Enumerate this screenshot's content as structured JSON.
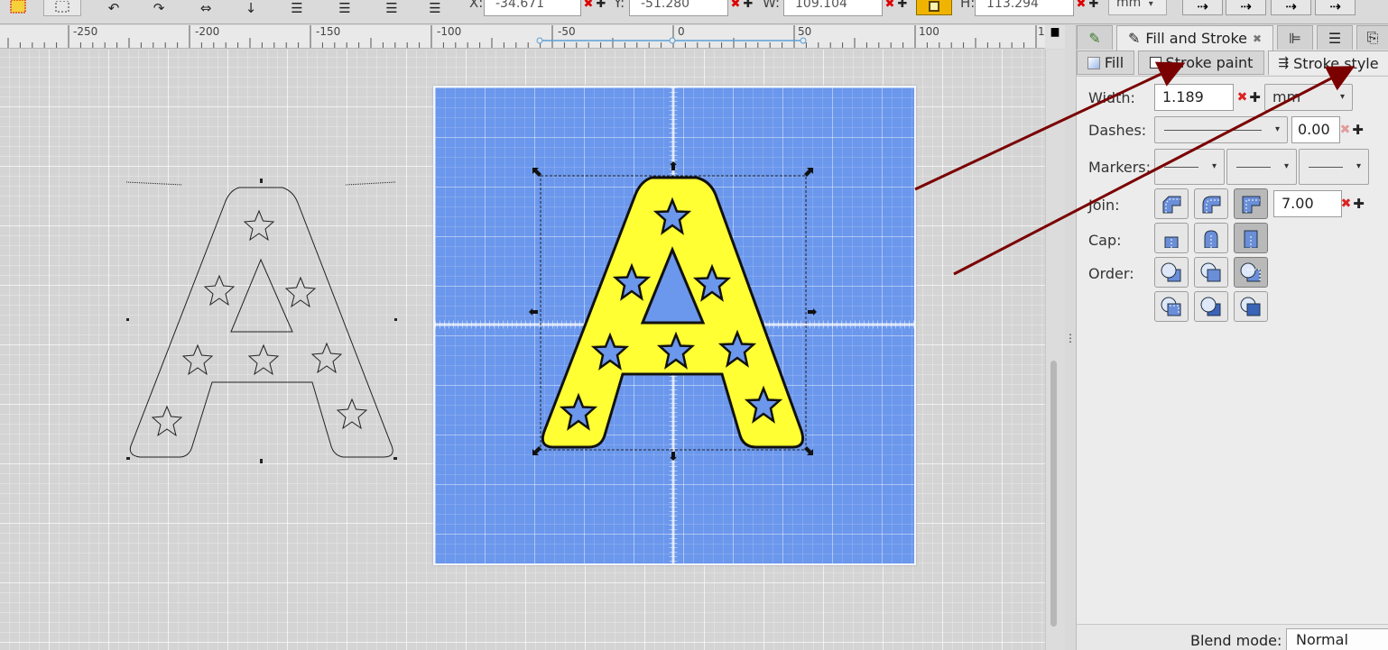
{
  "toolbar": {
    "x_label": "X:",
    "x_value": "-34.671",
    "y_label": "Y:",
    "y_value": "-51.280",
    "w_label": "W:",
    "w_value": "109.104",
    "h_label": "H:",
    "h_value": "113.294",
    "unit": "mm",
    "unit_arrow": "▾"
  },
  "ruler": {
    "labels": [
      "-250",
      "-200",
      "-150",
      "-100",
      "-50",
      "0",
      "50",
      "100",
      "1"
    ]
  },
  "dock": {
    "tabs": [
      {
        "label": "",
        "icon": "pen-icon"
      },
      {
        "label": "Fill and Stroke",
        "icon": "fill-stroke-icon",
        "close": "✖",
        "active": true
      },
      {
        "label": "",
        "icon": "align-icon"
      },
      {
        "label": "",
        "icon": "layers-icon"
      },
      {
        "label": "",
        "icon": "export-icon"
      }
    ],
    "subtabs": [
      {
        "label": "Fill",
        "icon": "fill-swatch-icon"
      },
      {
        "label": "Stroke paint",
        "icon": "stroke-paint-icon"
      },
      {
        "label": "Stroke style",
        "icon": "stroke-style-icon",
        "active": true
      }
    ]
  },
  "stroke_style": {
    "width_label": "Width:",
    "width_value": "1.189",
    "width_unit": "mm",
    "dashes_label": "Dashes:",
    "dash_offset": "0.00",
    "markers_label": "Markers:",
    "join_label": "Join:",
    "miter_limit": "7.00",
    "cap_label": "Cap:",
    "order_label": "Order:",
    "clear_symbol": "✖",
    "plus_symbol": "✚",
    "arrow_symbol": "▾",
    "join_options": [
      "bevel-join",
      "round-join",
      "miter-join"
    ],
    "join_selected": "miter-join",
    "cap_options": [
      "butt-cap",
      "round-cap",
      "square-cap"
    ],
    "cap_selected": "square-cap",
    "order_selected": "order-3"
  },
  "blend": {
    "label": "Blend mode:",
    "value": "Normal"
  },
  "colors": {
    "artboard": "#6b97ec",
    "letter_fill": "#ffff33",
    "annotation_arrow": "#7a0000",
    "panel_bg": "#ececec"
  }
}
